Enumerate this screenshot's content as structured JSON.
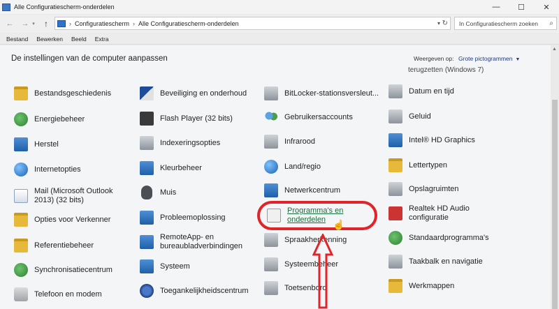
{
  "window": {
    "title": "Alle Configuratiescherm-onderdelen",
    "controls": [
      "—",
      "☐",
      "✕"
    ]
  },
  "nav": {
    "back": "←",
    "forward": "→",
    "up": "↑"
  },
  "breadcrumb": [
    "Configuratiescherm",
    "Alle Configuratiescherm-onderdelen"
  ],
  "search": {
    "placeholder": "In Configuratiescherm zoeken"
  },
  "menu": [
    "Bestand",
    "Bewerken",
    "Beeld",
    "Extra"
  ],
  "content": {
    "heading": "De instellingen van de computer aanpassen",
    "view_label": "Weergeven op:",
    "view_value": "Grote pictogrammen",
    "partial_item": "terugzetten (Windows 7)"
  },
  "items": [
    {
      "label": "Bestandsgeschiedenis",
      "icon": "folder-icon"
    },
    {
      "label": "Energiebeheer",
      "icon": "power-icon"
    },
    {
      "label": "Herstel",
      "icon": "recovery-icon"
    },
    {
      "label": "Internetopties",
      "icon": "globe-icon"
    },
    {
      "label": "Mail (Microsoft Outlook 2013) (32 bits)",
      "icon": "mail-icon"
    },
    {
      "label": "Opties voor Verkenner",
      "icon": "folder-options-icon"
    },
    {
      "label": "Referentiebeheer",
      "icon": "credential-icon"
    },
    {
      "label": "Synchronisatiecentrum",
      "icon": "sync-icon"
    },
    {
      "label": "Telefoon en modem",
      "icon": "phone-icon"
    },
    {
      "label": "Beveiliging en onderhoud",
      "icon": "flag-icon"
    },
    {
      "label": "Flash Player (32 bits)",
      "icon": "flash-icon"
    },
    {
      "label": "Indexeringsopties",
      "icon": "indexing-icon"
    },
    {
      "label": "Kleurbeheer",
      "icon": "color-management-icon"
    },
    {
      "label": "Muis",
      "icon": "mouse-icon"
    },
    {
      "label": "Probleemoplossing",
      "icon": "troubleshoot-icon"
    },
    {
      "label": "RemoteApp- en bureaubladverbindingen",
      "icon": "remoteapp-icon"
    },
    {
      "label": "Systeem",
      "icon": "system-icon"
    },
    {
      "label": "Toegankelijkheidscentrum",
      "icon": "accessibility-icon"
    },
    {
      "label": "BitLocker-stationsversleut...",
      "icon": "bitlocker-icon"
    },
    {
      "label": "Gebruikersaccounts",
      "icon": "user-accounts-icon"
    },
    {
      "label": "Infrarood",
      "icon": "infrared-icon"
    },
    {
      "label": "Land/regio",
      "icon": "region-icon"
    },
    {
      "label": "Netwerkcentrum",
      "icon": "network-icon"
    },
    {
      "label": "Programma's en onderdelen",
      "icon": "programs-icon"
    },
    {
      "label": "Spraakherkenning",
      "icon": "microphone-icon"
    },
    {
      "label": "Systeembeheer",
      "icon": "admin-tools-icon"
    },
    {
      "label": "Toetsenbord",
      "icon": "keyboard-icon"
    },
    {
      "label": "Datum en tijd",
      "icon": "clock-icon"
    },
    {
      "label": "Geluid",
      "icon": "speaker-icon"
    },
    {
      "label": "Intel® HD Graphics",
      "icon": "intel-icon"
    },
    {
      "label": "Lettertypen",
      "icon": "fonts-icon"
    },
    {
      "label": "Opslagruimten",
      "icon": "storage-icon"
    },
    {
      "label": "Realtek HD Audio configuratie",
      "icon": "realtek-icon"
    },
    {
      "label": "Standaardprogramma's",
      "icon": "default-programs-icon"
    },
    {
      "label": "Taakbalk en navigatie",
      "icon": "taskbar-icon"
    },
    {
      "label": "Werkmappen",
      "icon": "work-folders-icon"
    }
  ],
  "colors": {
    "highlight": "#e0242a",
    "link": "#1a6e3d"
  }
}
